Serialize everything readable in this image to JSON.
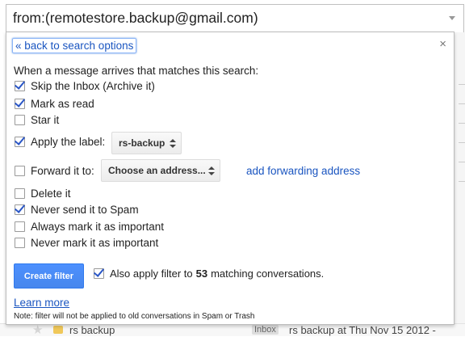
{
  "search": {
    "query": "from:(remotestore.backup@gmail.com)"
  },
  "panel": {
    "back_link": "« back to search options",
    "close_icon": "×",
    "intro": "When a message arrives that matches this search:",
    "options": {
      "skip_inbox": {
        "label": "Skip the Inbox (Archive it)",
        "checked": true
      },
      "mark_read": {
        "label": "Mark as read",
        "checked": true
      },
      "star": {
        "label": "Star it",
        "checked": false
      },
      "apply_label": {
        "label": "Apply the label:",
        "checked": true,
        "value": "rs-backup"
      },
      "forward": {
        "label": "Forward it to:",
        "checked": false,
        "value": "Choose an address..."
      },
      "delete": {
        "label": "Delete it",
        "checked": false
      },
      "never_spam": {
        "label": "Never send it to Spam",
        "checked": true
      },
      "always_important": {
        "label": "Always mark it as important",
        "checked": false
      },
      "never_important": {
        "label": "Never mark it as important",
        "checked": false
      }
    },
    "add_forwarding": "add forwarding address",
    "create_button": "Create filter",
    "also_apply": {
      "prefix": "Also apply filter to",
      "count": "53",
      "suffix": "matching conversations.",
      "checked": true
    },
    "learn_more": "Learn more",
    "note": "Note: filter will not be applied to old conversations in Spam or Trash"
  },
  "background_row": {
    "sender": "rs backup",
    "badge": "Inbox",
    "subject": "rs backup at Thu Nov 15 2012 -"
  },
  "colors": {
    "link": "#1a55c0",
    "button": "#4d90fe",
    "check": "#2a56c6"
  },
  "icons": {
    "close": "close-icon",
    "caret": "chevron-down-icon",
    "check": "checkmark-icon",
    "star": "star-icon"
  }
}
